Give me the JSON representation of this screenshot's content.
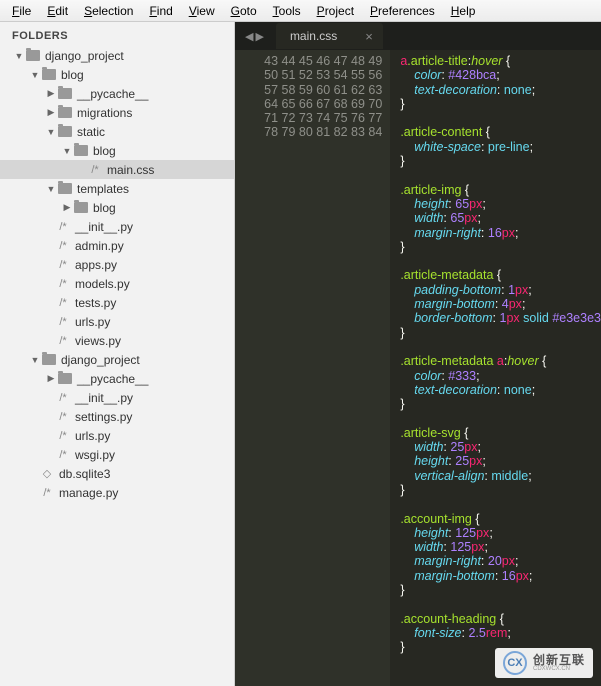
{
  "menubar": [
    "File",
    "Edit",
    "Selection",
    "Find",
    "View",
    "Goto",
    "Tools",
    "Project",
    "Preferences",
    "Help"
  ],
  "sidebar": {
    "header": "FOLDERS",
    "tree": [
      {
        "depth": 0,
        "arrow": "down",
        "kind": "folder",
        "label": "django_project"
      },
      {
        "depth": 1,
        "arrow": "down",
        "kind": "folder",
        "label": "blog"
      },
      {
        "depth": 2,
        "arrow": "right",
        "kind": "folder",
        "label": "__pycache__"
      },
      {
        "depth": 2,
        "arrow": "right",
        "kind": "folder",
        "label": "migrations"
      },
      {
        "depth": 2,
        "arrow": "down",
        "kind": "folder",
        "label": "static"
      },
      {
        "depth": 3,
        "arrow": "down",
        "kind": "folder",
        "label": "blog"
      },
      {
        "depth": 4,
        "arrow": "none",
        "kind": "file",
        "label": "main.css",
        "selected": true
      },
      {
        "depth": 2,
        "arrow": "down",
        "kind": "folder",
        "label": "templates"
      },
      {
        "depth": 3,
        "arrow": "right",
        "kind": "folder",
        "label": "blog"
      },
      {
        "depth": 2,
        "arrow": "none",
        "kind": "file",
        "label": "__init__.py"
      },
      {
        "depth": 2,
        "arrow": "none",
        "kind": "file",
        "label": "admin.py"
      },
      {
        "depth": 2,
        "arrow": "none",
        "kind": "file",
        "label": "apps.py"
      },
      {
        "depth": 2,
        "arrow": "none",
        "kind": "file",
        "label": "models.py"
      },
      {
        "depth": 2,
        "arrow": "none",
        "kind": "file",
        "label": "tests.py"
      },
      {
        "depth": 2,
        "arrow": "none",
        "kind": "file",
        "label": "urls.py"
      },
      {
        "depth": 2,
        "arrow": "none",
        "kind": "file",
        "label": "views.py"
      },
      {
        "depth": 1,
        "arrow": "down",
        "kind": "folder",
        "label": "django_project"
      },
      {
        "depth": 2,
        "arrow": "right",
        "kind": "folder",
        "label": "__pycache__"
      },
      {
        "depth": 2,
        "arrow": "none",
        "kind": "file",
        "label": "__init__.py"
      },
      {
        "depth": 2,
        "arrow": "none",
        "kind": "file",
        "label": "settings.py"
      },
      {
        "depth": 2,
        "arrow": "none",
        "kind": "file",
        "label": "urls.py"
      },
      {
        "depth": 2,
        "arrow": "none",
        "kind": "file",
        "label": "wsgi.py"
      },
      {
        "depth": 1,
        "arrow": "none",
        "kind": "file",
        "label": "db.sqlite3",
        "glyph": "◇"
      },
      {
        "depth": 1,
        "arrow": "none",
        "kind": "file",
        "label": "manage.py"
      }
    ]
  },
  "tab": {
    "name": "main.css"
  },
  "gutter_start": 43,
  "lines": [
    [
      {
        "t": "a",
        "c": "c-tag"
      },
      {
        "t": ".article-title",
        "c": "c-sel"
      },
      {
        "t": ":",
        "c": "c-punc"
      },
      {
        "t": "hover",
        "c": "c-pseudo"
      },
      {
        "t": " {",
        "c": "c-punc"
      }
    ],
    [
      {
        "t": "    ",
        "c": ""
      },
      {
        "t": "color",
        "c": "c-prop"
      },
      {
        "t": ": ",
        "c": "c-punc"
      },
      {
        "t": "#428bca",
        "c": "c-hex"
      },
      {
        "t": ";",
        "c": "c-punc"
      }
    ],
    [
      {
        "t": "    ",
        "c": ""
      },
      {
        "t": "text-decoration",
        "c": "c-prop"
      },
      {
        "t": ": ",
        "c": "c-punc"
      },
      {
        "t": "none",
        "c": "c-val"
      },
      {
        "t": ";",
        "c": "c-punc"
      }
    ],
    [
      {
        "t": "}",
        "c": "c-punc"
      }
    ],
    [],
    [
      {
        "t": ".article-content",
        "c": "c-sel"
      },
      {
        "t": " {",
        "c": "c-punc"
      }
    ],
    [
      {
        "t": "    ",
        "c": ""
      },
      {
        "t": "white-space",
        "c": "c-prop"
      },
      {
        "t": ": ",
        "c": "c-punc"
      },
      {
        "t": "pre-line",
        "c": "c-val"
      },
      {
        "t": ";",
        "c": "c-punc"
      }
    ],
    [
      {
        "t": "}",
        "c": "c-punc"
      }
    ],
    [],
    [
      {
        "t": ".article-img",
        "c": "c-sel"
      },
      {
        "t": " {",
        "c": "c-punc"
      }
    ],
    [
      {
        "t": "    ",
        "c": ""
      },
      {
        "t": "height",
        "c": "c-prop"
      },
      {
        "t": ": ",
        "c": "c-punc"
      },
      {
        "t": "65",
        "c": "c-num"
      },
      {
        "t": "px",
        "c": "c-unit"
      },
      {
        "t": ";",
        "c": "c-punc"
      }
    ],
    [
      {
        "t": "    ",
        "c": ""
      },
      {
        "t": "width",
        "c": "c-prop"
      },
      {
        "t": ": ",
        "c": "c-punc"
      },
      {
        "t": "65",
        "c": "c-num"
      },
      {
        "t": "px",
        "c": "c-unit"
      },
      {
        "t": ";",
        "c": "c-punc"
      }
    ],
    [
      {
        "t": "    ",
        "c": ""
      },
      {
        "t": "margin-right",
        "c": "c-prop"
      },
      {
        "t": ": ",
        "c": "c-punc"
      },
      {
        "t": "16",
        "c": "c-num"
      },
      {
        "t": "px",
        "c": "c-unit"
      },
      {
        "t": ";",
        "c": "c-punc"
      }
    ],
    [
      {
        "t": "}",
        "c": "c-punc"
      }
    ],
    [],
    [
      {
        "t": ".article-metadata",
        "c": "c-sel"
      },
      {
        "t": " {",
        "c": "c-punc"
      }
    ],
    [
      {
        "t": "    ",
        "c": ""
      },
      {
        "t": "padding-bottom",
        "c": "c-prop"
      },
      {
        "t": ": ",
        "c": "c-punc"
      },
      {
        "t": "1",
        "c": "c-num"
      },
      {
        "t": "px",
        "c": "c-unit"
      },
      {
        "t": ";",
        "c": "c-punc"
      }
    ],
    [
      {
        "t": "    ",
        "c": ""
      },
      {
        "t": "margin-bottom",
        "c": "c-prop"
      },
      {
        "t": ": ",
        "c": "c-punc"
      },
      {
        "t": "4",
        "c": "c-num"
      },
      {
        "t": "px",
        "c": "c-unit"
      },
      {
        "t": ";",
        "c": "c-punc"
      }
    ],
    [
      {
        "t": "    ",
        "c": ""
      },
      {
        "t": "border-bottom",
        "c": "c-prop"
      },
      {
        "t": ": ",
        "c": "c-punc"
      },
      {
        "t": "1",
        "c": "c-num"
      },
      {
        "t": "px",
        "c": "c-unit"
      },
      {
        "t": " ",
        "c": ""
      },
      {
        "t": "solid",
        "c": "c-val"
      },
      {
        "t": " ",
        "c": ""
      },
      {
        "t": "#e3e3e3",
        "c": "c-hex"
      }
    ],
    [
      {
        "t": "}",
        "c": "c-punc"
      }
    ],
    [],
    [
      {
        "t": ".article-metadata",
        "c": "c-sel"
      },
      {
        "t": " ",
        "c": ""
      },
      {
        "t": "a",
        "c": "c-tag"
      },
      {
        "t": ":",
        "c": "c-punc"
      },
      {
        "t": "hover",
        "c": "c-pseudo"
      },
      {
        "t": " {",
        "c": "c-punc"
      }
    ],
    [
      {
        "t": "    ",
        "c": ""
      },
      {
        "t": "color",
        "c": "c-prop"
      },
      {
        "t": ": ",
        "c": "c-punc"
      },
      {
        "t": "#333",
        "c": "c-hex"
      },
      {
        "t": ";",
        "c": "c-punc"
      }
    ],
    [
      {
        "t": "    ",
        "c": ""
      },
      {
        "t": "text-decoration",
        "c": "c-prop"
      },
      {
        "t": ": ",
        "c": "c-punc"
      },
      {
        "t": "none",
        "c": "c-val"
      },
      {
        "t": ";",
        "c": "c-punc"
      }
    ],
    [
      {
        "t": "}",
        "c": "c-punc"
      }
    ],
    [],
    [
      {
        "t": ".article-svg",
        "c": "c-sel"
      },
      {
        "t": " {",
        "c": "c-punc"
      }
    ],
    [
      {
        "t": "    ",
        "c": ""
      },
      {
        "t": "width",
        "c": "c-prop"
      },
      {
        "t": ": ",
        "c": "c-punc"
      },
      {
        "t": "25",
        "c": "c-num"
      },
      {
        "t": "px",
        "c": "c-unit"
      },
      {
        "t": ";",
        "c": "c-punc"
      }
    ],
    [
      {
        "t": "    ",
        "c": ""
      },
      {
        "t": "height",
        "c": "c-prop"
      },
      {
        "t": ": ",
        "c": "c-punc"
      },
      {
        "t": "25",
        "c": "c-num"
      },
      {
        "t": "px",
        "c": "c-unit"
      },
      {
        "t": ";",
        "c": "c-punc"
      }
    ],
    [
      {
        "t": "    ",
        "c": ""
      },
      {
        "t": "vertical-align",
        "c": "c-prop"
      },
      {
        "t": ": ",
        "c": "c-punc"
      },
      {
        "t": "middle",
        "c": "c-val"
      },
      {
        "t": ";",
        "c": "c-punc"
      }
    ],
    [
      {
        "t": "}",
        "c": "c-punc"
      }
    ],
    [],
    [
      {
        "t": ".account-img",
        "c": "c-sel"
      },
      {
        "t": " {",
        "c": "c-punc"
      }
    ],
    [
      {
        "t": "    ",
        "c": ""
      },
      {
        "t": "height",
        "c": "c-prop"
      },
      {
        "t": ": ",
        "c": "c-punc"
      },
      {
        "t": "125",
        "c": "c-num"
      },
      {
        "t": "px",
        "c": "c-unit"
      },
      {
        "t": ";",
        "c": "c-punc"
      }
    ],
    [
      {
        "t": "    ",
        "c": ""
      },
      {
        "t": "width",
        "c": "c-prop"
      },
      {
        "t": ": ",
        "c": "c-punc"
      },
      {
        "t": "125",
        "c": "c-num"
      },
      {
        "t": "px",
        "c": "c-unit"
      },
      {
        "t": ";",
        "c": "c-punc"
      }
    ],
    [
      {
        "t": "    ",
        "c": ""
      },
      {
        "t": "margin-right",
        "c": "c-prop"
      },
      {
        "t": ": ",
        "c": "c-punc"
      },
      {
        "t": "20",
        "c": "c-num"
      },
      {
        "t": "px",
        "c": "c-unit"
      },
      {
        "t": ";",
        "c": "c-punc"
      }
    ],
    [
      {
        "t": "    ",
        "c": ""
      },
      {
        "t": "margin-bottom",
        "c": "c-prop"
      },
      {
        "t": ": ",
        "c": "c-punc"
      },
      {
        "t": "16",
        "c": "c-num"
      },
      {
        "t": "px",
        "c": "c-unit"
      },
      {
        "t": ";",
        "c": "c-punc"
      }
    ],
    [
      {
        "t": "}",
        "c": "c-punc"
      }
    ],
    [],
    [
      {
        "t": ".account-heading",
        "c": "c-sel"
      },
      {
        "t": " {",
        "c": "c-punc"
      }
    ],
    [
      {
        "t": "    ",
        "c": ""
      },
      {
        "t": "font-size",
        "c": "c-prop"
      },
      {
        "t": ": ",
        "c": "c-punc"
      },
      {
        "t": "2.5",
        "c": "c-num"
      },
      {
        "t": "rem",
        "c": "c-unit"
      },
      {
        "t": ";",
        "c": "c-punc"
      }
    ],
    [
      {
        "t": "}",
        "c": "c-punc"
      }
    ]
  ],
  "watermark": {
    "badge": "CX",
    "top": "创新互联",
    "bottom": "CDXWCX.CN"
  }
}
